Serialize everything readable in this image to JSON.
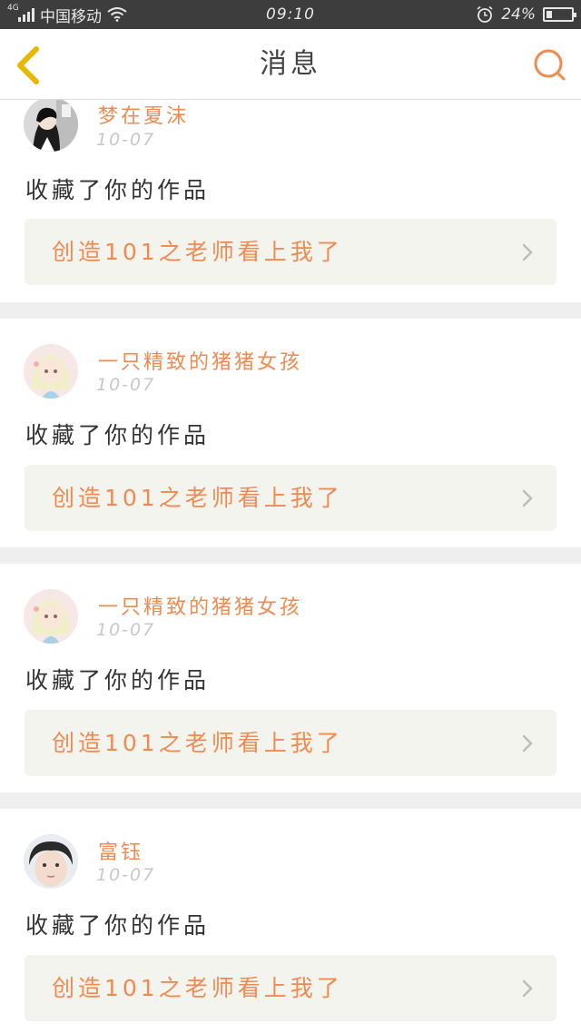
{
  "status_bar": {
    "network_tag": "4G",
    "carrier": "中国移动",
    "time": "09:10",
    "battery_percent_text": "24%",
    "battery_level": 0.24,
    "icons": [
      "signal-icon",
      "wifi-icon",
      "alarm-icon",
      "battery-icon"
    ]
  },
  "nav": {
    "title": "消息",
    "back_icon": "chevron-left-icon",
    "search_icon": "search-icon",
    "accent_color": "#f08a50",
    "back_color": "#e8b800"
  },
  "notifications": [
    {
      "username": "梦在夏沫",
      "date": "10-07",
      "action": "收藏了你的作品",
      "work_title": "创造101之老师看上我了",
      "avatar": "dark-haired-girl-avatar"
    },
    {
      "username": "一只精致的猪猪女孩",
      "date": "10-07",
      "action": "收藏了你的作品",
      "work_title": "创造101之老师看上我了",
      "avatar": "anime-girl-avatar"
    },
    {
      "username": "一只精致的猪猪女孩",
      "date": "10-07",
      "action": "收藏了你的作品",
      "work_title": "创造101之老师看上我了",
      "avatar": "anime-girl-avatar"
    },
    {
      "username": "富钰",
      "date": "10-07",
      "action": "收藏了你的作品",
      "work_title": "创造101之老师看上我了",
      "avatar": "child-face-avatar"
    }
  ]
}
